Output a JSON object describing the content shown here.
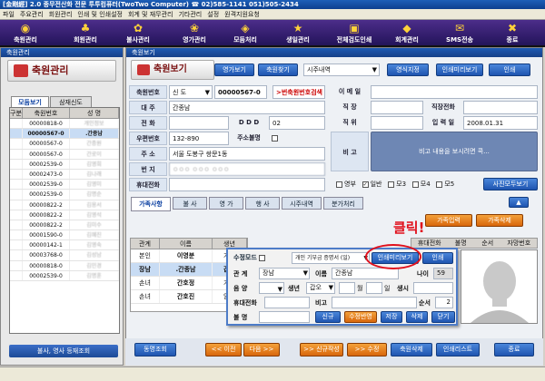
{
  "app": {
    "title": "[金剛經] 2.0 종무전산화 전문 투투컴퓨터(TwoTwo Computer) ☎ 02)585-1141  051)505-2434"
  },
  "menu": [
    "파일",
    "주요관리",
    "회원관리",
    "인쇄 및 인쇄설정",
    "회계 및 재무관리",
    "기타관리",
    "설정",
    "원격지원요청"
  ],
  "toolbar": [
    {
      "label": "축원관리",
      "icon": "◉"
    },
    {
      "label": "회원관리",
      "icon": "♣"
    },
    {
      "label": "불사관리",
      "icon": "✿"
    },
    {
      "label": "영가관리",
      "icon": "❀"
    },
    {
      "label": "모둠처리",
      "icon": "◈"
    },
    {
      "label": "생일관리",
      "icon": "★"
    },
    {
      "label": "전체검도인쇄",
      "icon": "▣"
    },
    {
      "label": "회계관리",
      "icon": "◆"
    },
    {
      "label": "SMS전송",
      "icon": "✉"
    },
    {
      "label": "종료",
      "icon": "✖"
    }
  ],
  "left": {
    "panel_title": "축원관리",
    "header": "축원관리",
    "tabs": [
      "모둠보기",
      "삼재신도"
    ],
    "grid_header": [
      "구분",
      "축원번호",
      "성  명"
    ],
    "rows": [
      [
        "",
        "00000818-0",
        "개인정보"
      ],
      [
        "",
        "00000567-0",
        ".간종남"
      ],
      [
        "",
        "00000567-0",
        "간종원"
      ],
      [
        "",
        "00000567-0",
        "간로이"
      ],
      [
        "",
        "00002539-0",
        "김영희"
      ],
      [
        "",
        "00002473-0",
        "김나래"
      ],
      [
        "",
        "00002539-0",
        "김영미"
      ],
      [
        "",
        "00002539-0",
        "김명순"
      ],
      [
        "",
        "00000822-2",
        "김용서"
      ],
      [
        "",
        "00000822-2",
        "김영석"
      ],
      [
        "",
        "00000822-2",
        "김미수"
      ],
      [
        "",
        "00001590-0",
        "김혜진"
      ],
      [
        "",
        "00000142-1",
        "김영숙"
      ],
      [
        "",
        "00003768-0",
        "김성남"
      ],
      [
        "",
        "00000818-0",
        "김민경"
      ],
      [
        "",
        "00002539-0",
        "김명훈"
      ]
    ],
    "bottom_btn": "불사, 영사 등재조회"
  },
  "main": {
    "panel_title": "축원보기",
    "header": "축원보기",
    "top_buttons": [
      "영가보기",
      "축원찾기",
      "시주내역",
      "영식지정",
      "인쇄미리보기",
      "인쇄"
    ],
    "fields": {
      "no_label": "축원번호",
      "no_type": "신 도",
      "no_value": "00000567-0",
      "no_btn": ">번축원번호검색",
      "email_label": "이 메 일",
      "email": "",
      "head_label": "대    주",
      "head": "간종남",
      "job_label": "직    장",
      "job": "",
      "jobtel_label": "직장전화",
      "jobtel": "",
      "tel_label": "전    화",
      "ddd_label": "D D D",
      "ddd": "02",
      "position_label": "직    위",
      "position": "",
      "date_label": "입 력 일",
      "date": "2008.01.31",
      "zip_label": "우편번호",
      "zip": "132-890",
      "addrcheck_label": "주소불명",
      "addr_label": "주    소",
      "addr": "서울 도봉구 쌍문1동",
      "addr2": "",
      "memo_label": "비    고",
      "memo_btn": "비고 내용을 보시려면 콕...",
      "bunji_label": "번    지",
      "bunji": "ㅇㅇㅇ ㅇㅇㅇ ㅇㅇㅇ",
      "mobile_label": "휴대전화",
      "mobile": "",
      "checks": [
        "영부",
        "일반",
        "모3",
        "모4",
        "모5"
      ],
      "checked": 1,
      "photo_btn": "사진모두보기"
    },
    "tabs": [
      "가족사항",
      "불  사",
      "영  가",
      "행  사",
      "시주내역",
      "분가처리"
    ],
    "fam_btns": [
      "가족입력",
      "가족삭제"
    ],
    "fam_header": [
      "관계",
      "이름",
      "생년"
    ],
    "fam_rows": [
      [
        "본인",
        "이영분",
        "기사"
      ],
      [
        "장남",
        ".간종남",
        "갑오"
      ],
      [
        "손녀",
        "간호정",
        "기미"
      ],
      [
        "손녀",
        "간호진",
        "임술"
      ]
    ],
    "right_header": [
      "휴대전화",
      "불명",
      "순서",
      "자망번호"
    ],
    "callout": "클릭!",
    "bottom": [
      "동명조회",
      "<< 이전",
      "다음 >>",
      ">> 신규작성",
      ">> 수정",
      "축원삭제",
      "인쇄리스트",
      "종료"
    ]
  },
  "popup": {
    "title": "수정모드",
    "dropdown": "개인 기부금 증명서 (일)",
    "btn_preview": "인쇄미리보기",
    "btn_print": "인쇄",
    "rel_label": "관    계",
    "rel": "장남",
    "name_label": "이름",
    "name": "간종남",
    "age_label": "나이",
    "age": "59",
    "gender_label": "음    양",
    "birth_label": "생년",
    "birth": "갑오",
    "m_label": "월",
    "d_label": "일",
    "time_label": "생시",
    "phone_label": "휴대전화",
    "memo_label": "비고",
    "order_label": "순서",
    "order": "2",
    "unknown_label": "불    명",
    "buttons": [
      "신규",
      "수정반영",
      "저장",
      "삭제",
      "닫기"
    ]
  }
}
